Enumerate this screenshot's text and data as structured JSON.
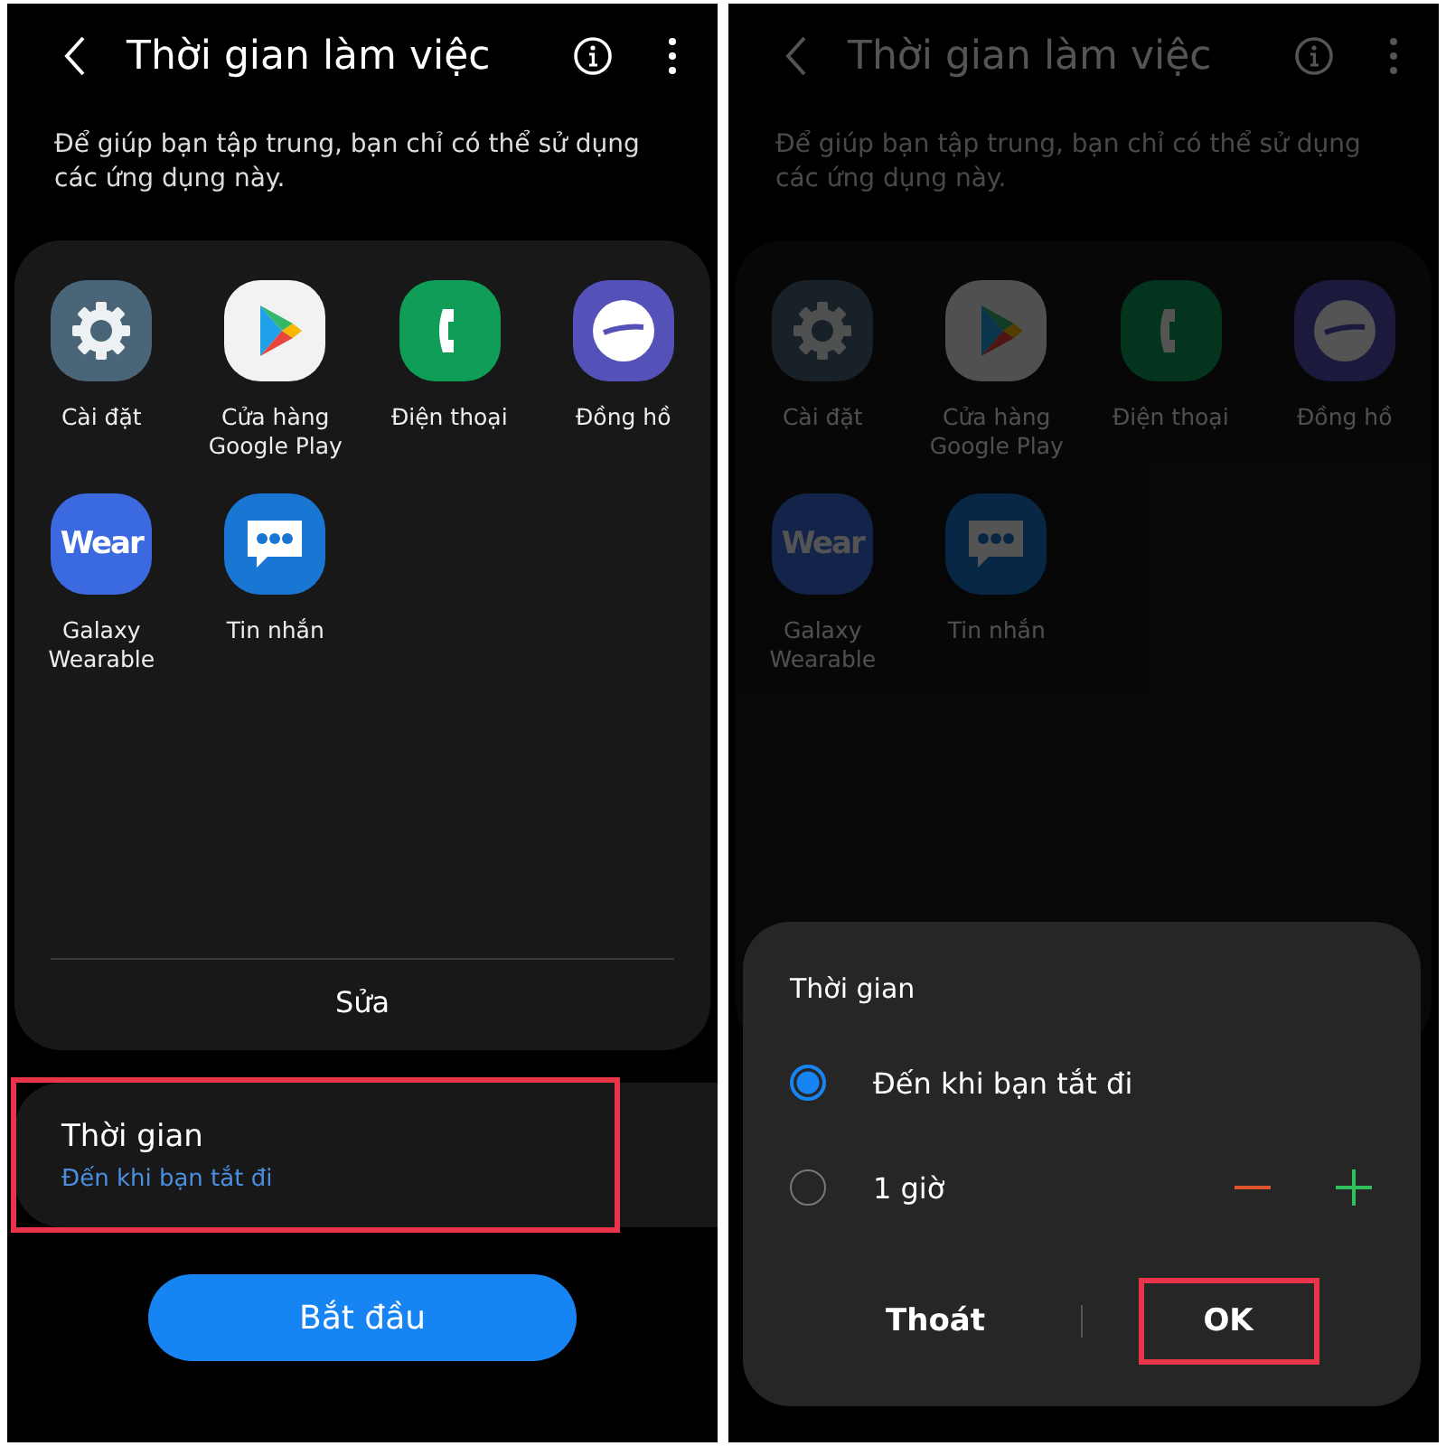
{
  "panels": [
    {
      "dimmed": false,
      "title": "Thời gian làm việc",
      "description": "Để giúp bạn tập trung, bạn chỉ có thể sử dụng các ứng dụng này.",
      "apps": [
        {
          "kind": "settings",
          "label": "Cài đặt"
        },
        {
          "kind": "play",
          "label": "Cửa hàng Google Play"
        },
        {
          "kind": "phone",
          "label": "Điện thoại"
        },
        {
          "kind": "clock",
          "label": "Đồng hồ"
        },
        {
          "kind": "wear",
          "label": "Galaxy Wearable",
          "icon_text": "Wear"
        },
        {
          "kind": "messages",
          "label": "Tin nhắn"
        }
      ],
      "edit_button": "Sửa",
      "time_setting": {
        "label": "Thời gian",
        "value": "Đến khi bạn tắt đi",
        "highlighted": true
      },
      "start_button": "Bắt đầu"
    },
    {
      "dimmed": true,
      "title": "Thời gian làm việc",
      "description": "Để giúp bạn tập trung, bạn chỉ có thể sử dụng các ứng dụng này.",
      "apps": [
        {
          "kind": "settings",
          "label": "Cài đặt"
        },
        {
          "kind": "play",
          "label": "Cửa hàng Google Play"
        },
        {
          "kind": "phone",
          "label": "Điện thoại"
        },
        {
          "kind": "clock",
          "label": "Đồng hồ"
        },
        {
          "kind": "wear",
          "label": "Galaxy Wearable",
          "icon_text": "Wear"
        },
        {
          "kind": "messages",
          "label": "Tin nhắn"
        }
      ],
      "dialog": {
        "title": "Thời gian",
        "options": [
          {
            "label": "Đến khi bạn tắt đi",
            "selected": true,
            "stepper": false
          },
          {
            "label": "1 giờ",
            "selected": false,
            "stepper": true
          }
        ],
        "buttons": [
          {
            "label": "Thoát",
            "highlighted": false
          },
          {
            "label": "OK",
            "highlighted": true
          }
        ]
      }
    }
  ]
}
